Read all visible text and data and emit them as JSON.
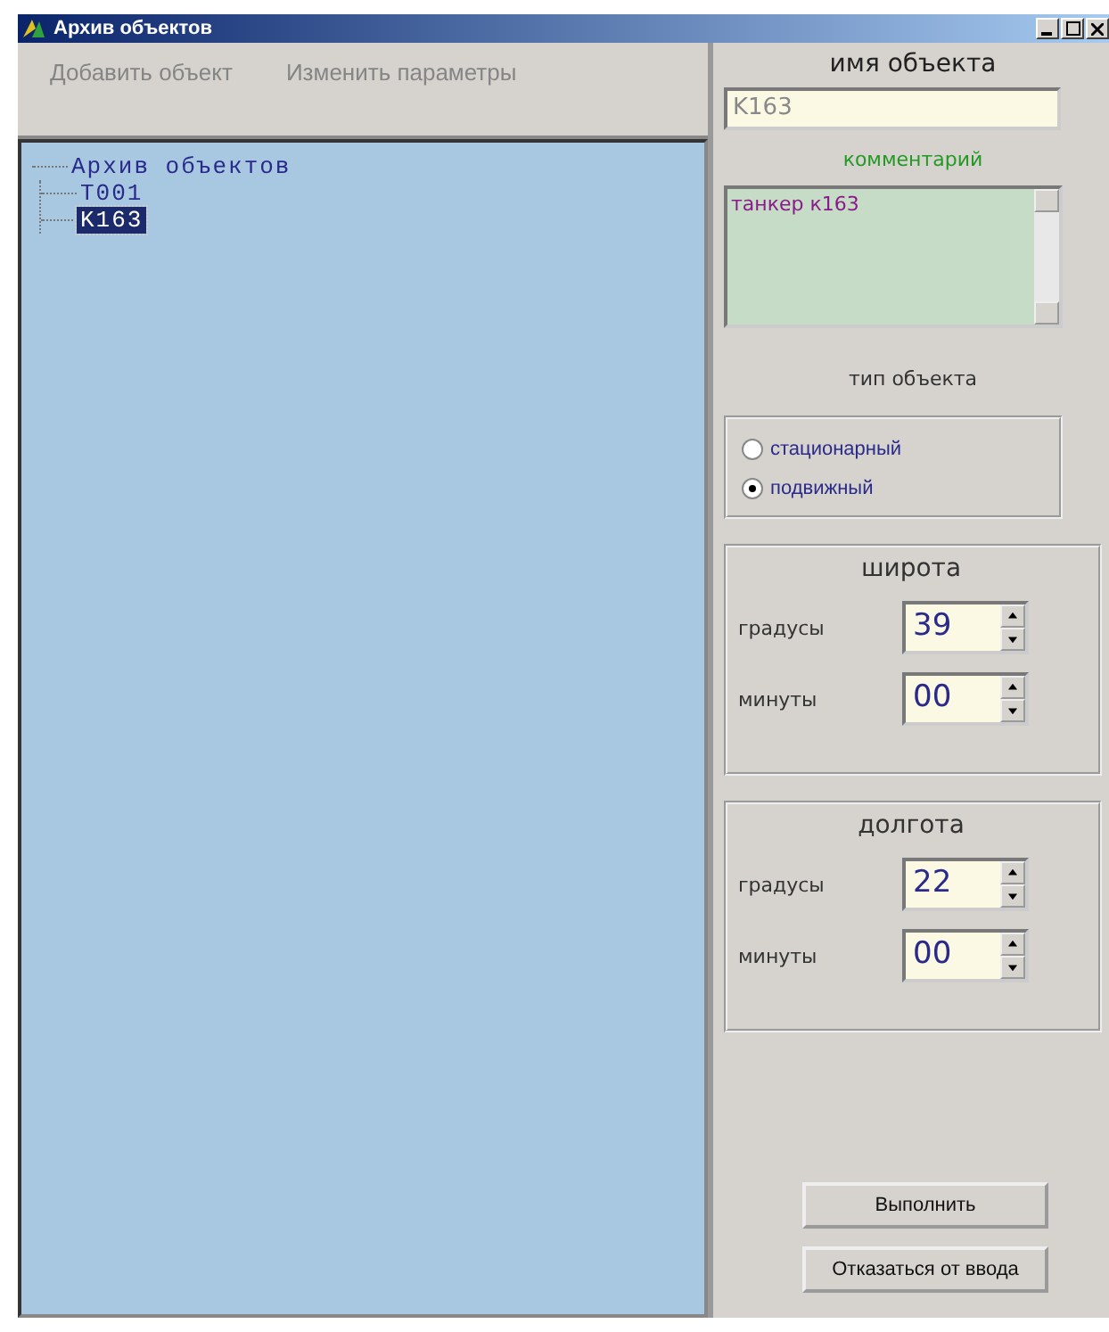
{
  "window": {
    "title": "Архив объектов"
  },
  "toolbar": [
    {
      "label": "Добавить объект",
      "disabled": true
    },
    {
      "label": "Изменить параметры",
      "disabled": true
    }
  ],
  "tree": {
    "label": "Архив объектов",
    "selected": false,
    "children": [
      {
        "label": "T001",
        "selected": false
      },
      {
        "label": "K163",
        "selected": true
      }
    ]
  },
  "name_field": {
    "label": "имя объекта",
    "value": "K163",
    "disabled": true
  },
  "comment": {
    "label": "комментарий",
    "value": "танкер к163"
  },
  "object_type": {
    "label": "тип объекта",
    "options": [
      {
        "label": "стационарный",
        "selected": false
      },
      {
        "label": "подвижный",
        "selected": true
      }
    ]
  },
  "latitude": {
    "title": "широта",
    "fields": [
      {
        "label": "градусы",
        "value": "39"
      },
      {
        "label": "минуты",
        "value": "00"
      }
    ]
  },
  "longitude": {
    "title": "долгота",
    "fields": [
      {
        "label": "градусы",
        "value": "22"
      },
      {
        "label": "минуты",
        "value": "00"
      }
    ]
  },
  "buttons": [
    "Выполнить",
    "Отказаться от ввода"
  ]
}
